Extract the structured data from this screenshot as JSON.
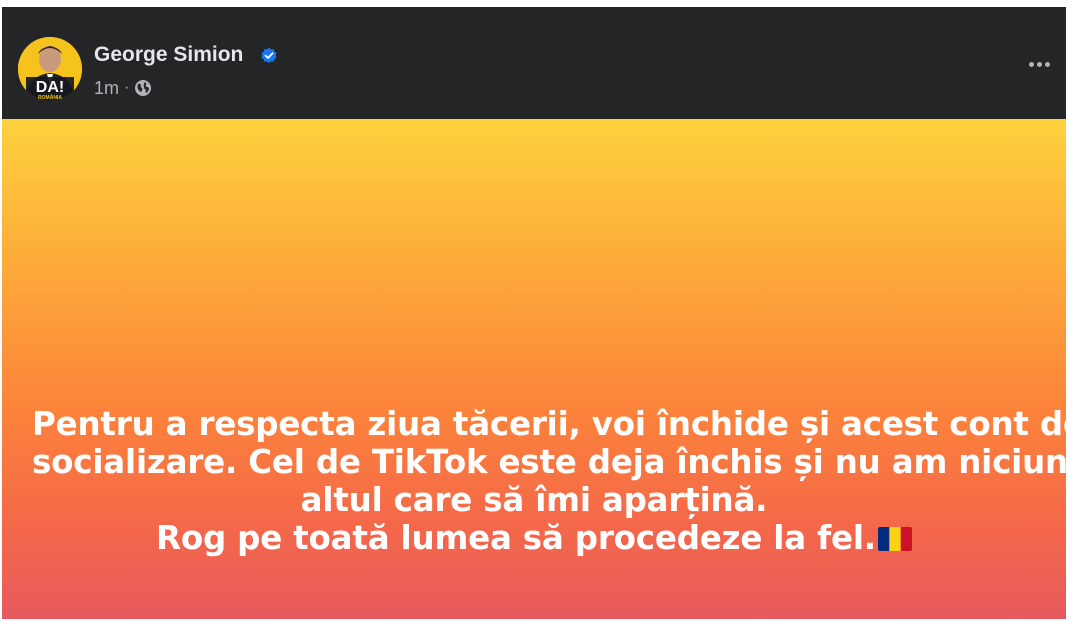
{
  "post": {
    "author": "George Simion",
    "timestamp": "1m",
    "separator": "·",
    "avatar_text": "DA!",
    "avatar_subtext": "ROMÂNIA",
    "privacy_icon": "globe-icon",
    "verified_icon": "verified-badge-icon",
    "more_icon": "more-options-icon",
    "text_lines": [
      "Pentru a respecta ziua tăcerii, voi închide și acest cont de",
      "socializare. Cel de TikTok este deja închis și nu am niciun",
      "altul care să îmi aparțină.",
      "Rog pe toată lumea să procedeze la fel."
    ],
    "emoji": "romania-flag",
    "colors": {
      "header_bg": "#242526",
      "gradient_top": "#fed23e",
      "gradient_bottom": "#e75a5e",
      "verified_blue": "#1877f2",
      "flag_blue": "#002b7f",
      "flag_yellow": "#fcd116",
      "flag_red": "#ce1126"
    }
  }
}
